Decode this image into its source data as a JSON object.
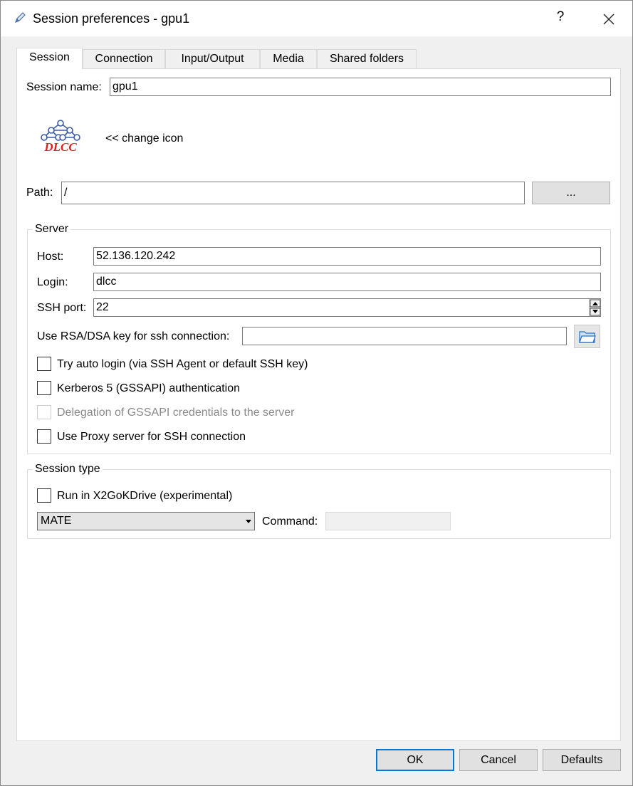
{
  "window": {
    "title": "Session preferences - gpu1",
    "help_label": "?"
  },
  "tabs": [
    {
      "label": "Session",
      "active": true
    },
    {
      "label": "Connection",
      "active": false
    },
    {
      "label": "Input/Output",
      "active": false
    },
    {
      "label": "Media",
      "active": false
    },
    {
      "label": "Shared folders",
      "active": false
    }
  ],
  "session": {
    "name_label": "Session name:",
    "name_value": "gpu1",
    "icon_text": "DLCC",
    "change_icon_label": "<< change icon",
    "path_label": "Path:",
    "path_value": "/",
    "browse_label": "..."
  },
  "server": {
    "group_title": "Server",
    "host_label": "Host:",
    "host_value": "52.136.120.242",
    "login_label": "Login:",
    "login_value": "dlcc",
    "port_label": "SSH port:",
    "port_value": "22",
    "rsa_label": "Use RSA/DSA key for ssh connection:",
    "rsa_value": "",
    "checkboxes": [
      {
        "label": "Try auto login (via SSH Agent or default SSH key)",
        "checked": false,
        "disabled": false
      },
      {
        "label": "Kerberos 5 (GSSAPI) authentication",
        "checked": false,
        "disabled": false
      },
      {
        "label": "Delegation of GSSAPI credentials to the server",
        "checked": false,
        "disabled": true
      },
      {
        "label": "Use Proxy server for SSH connection",
        "checked": false,
        "disabled": false
      }
    ]
  },
  "session_type": {
    "group_title": "Session type",
    "drive_label": "Run in X2GoKDrive (experimental)",
    "drive_checked": false,
    "type_value": "MATE",
    "command_label": "Command:",
    "command_value": ""
  },
  "footer": {
    "ok_label": "OK",
    "cancel_label": "Cancel",
    "defaults_label": "Defaults"
  },
  "colors": {
    "accent": "#0078d7",
    "icon_red": "#e0201b",
    "icon_blue": "#3a5aa8"
  }
}
